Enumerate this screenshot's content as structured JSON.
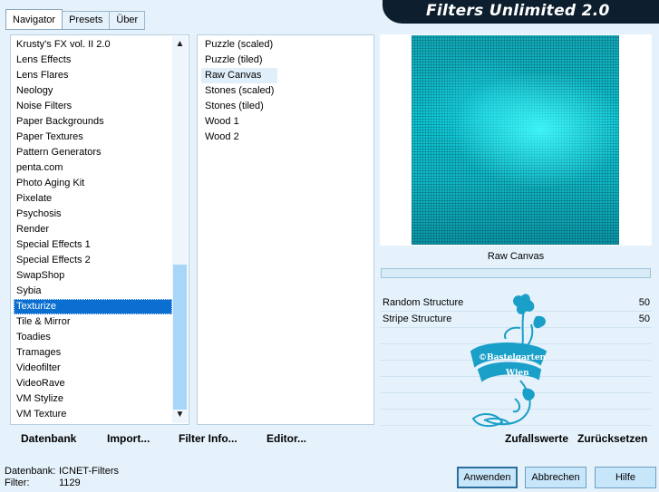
{
  "tabs": [
    "Navigator",
    "Presets",
    "Über"
  ],
  "app_title": "Filters Unlimited 2.0",
  "categories": [
    "Krusty's FX vol. II 2.0",
    "Lens Effects",
    "Lens Flares",
    "Neology",
    "Noise Filters",
    "Paper Backgrounds",
    "Paper Textures",
    "Pattern Generators",
    "penta.com",
    "Photo Aging Kit",
    "Pixelate",
    "Psychosis",
    "Render",
    "Special Effects 1",
    "Special Effects 2",
    "SwapShop",
    "Sybia",
    "Texturize",
    "Tile & Mirror",
    "Toadies",
    "Tramages",
    "Videofilter",
    "VideoRave",
    "VM Stylize",
    "VM Texture"
  ],
  "selected_category": "Texturize",
  "filters": [
    "Puzzle (scaled)",
    "Puzzle (tiled)",
    "Raw Canvas",
    "Stones (scaled)",
    "Stones (tiled)",
    "Wood 1",
    "Wood 2"
  ],
  "selected_filter": "Raw Canvas",
  "preview": {
    "filter_name": "Raw Canvas"
  },
  "params": [
    {
      "label": "Random Structure",
      "value": "50"
    },
    {
      "label": "Stripe Structure",
      "value": "50"
    }
  ],
  "watermark": {
    "line1": "©Bastelgarten",
    "line2": "Wien"
  },
  "links": {
    "datenbank": "Datenbank",
    "import": "Import...",
    "filter_info": "Filter Info...",
    "editor": "Editor..."
  },
  "right_links": {
    "random": "Zufallswerte",
    "reset": "Zurücksetzen"
  },
  "status": {
    "db_label": "Datenbank:",
    "db_value": "ICNET-Filters",
    "filter_label": "Filter:",
    "filter_value": "1129"
  },
  "buttons": {
    "apply": "Anwenden",
    "cancel": "Abbrechen",
    "help": "Hilfe"
  },
  "colors": {
    "selection": "#0a6fd0",
    "background": "#e6f2fb",
    "accent": "#a8d6f8",
    "banner": "#0d1f2e",
    "watermark": "#1a9fc9"
  },
  "icons": {
    "scroll_up": "▲",
    "scroll_down": "▼"
  }
}
